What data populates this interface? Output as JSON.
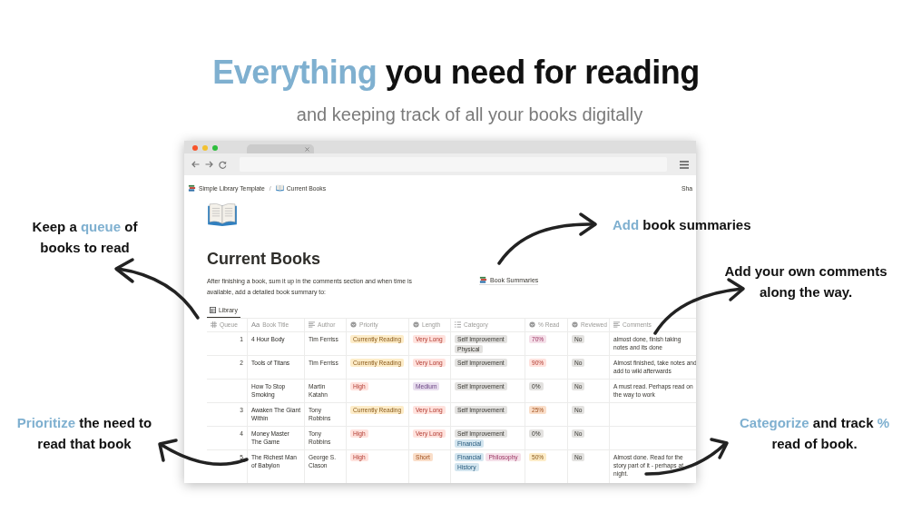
{
  "headline": {
    "accent": "Everything",
    "rest": "you need for reading"
  },
  "subtitle": "and keeping track of all your books digitally",
  "callouts": [
    {
      "segments": [
        {
          "text": "Keep a ",
          "accent": false
        },
        {
          "text": "queue",
          "accent": true
        },
        {
          "text": " of books to read",
          "accent": false
        }
      ]
    },
    {
      "segments": [
        {
          "text": "Add",
          "accent": true
        },
        {
          "text": " book summaries",
          "accent": false
        }
      ]
    },
    {
      "segments": [
        {
          "text": "Add your own comments along the way.",
          "accent": false
        }
      ]
    },
    {
      "segments": [
        {
          "text": "Prioritize",
          "accent": true
        },
        {
          "text": " the need to read that book",
          "accent": false
        }
      ]
    },
    {
      "segments": [
        {
          "text": "Categorize",
          "accent": true
        },
        {
          "text": " and track ",
          "accent": false
        },
        {
          "text": "%",
          "accent": true
        },
        {
          "text": " read of book.",
          "accent": false
        }
      ]
    }
  ],
  "page": {
    "breadcrumb": [
      "Simple Library Template",
      "/",
      "Current Books"
    ],
    "share": "Sha",
    "title": "Current Books",
    "description": "After finishing a book, sum it up in the comments section and when time is available, add a detailed book summary to:",
    "link": "Book Summaries",
    "view_tab": "Library",
    "table": {
      "columns": [
        {
          "label": "Queue",
          "kind": "number"
        },
        {
          "label": "Book Title",
          "kind": "title",
          "glyph": "Aa"
        },
        {
          "label": "Author",
          "kind": "text"
        },
        {
          "label": "Priority",
          "kind": "select"
        },
        {
          "label": "Length",
          "kind": "select"
        },
        {
          "label": "Category",
          "kind": "multi"
        },
        {
          "label": "% Read",
          "kind": "select"
        },
        {
          "label": "Reviewed",
          "kind": "select"
        },
        {
          "label": "Comments",
          "kind": "text"
        }
      ],
      "rows": [
        {
          "queue": "1",
          "title": "4 Hour Body",
          "author": "Tim Ferriss",
          "priority": {
            "text": "Currently Reading",
            "color": "#fdecc8"
          },
          "length": {
            "text": "Very Long",
            "color": "#ffe2dd"
          },
          "category": [
            {
              "text": "Self Improvement",
              "color": "#e3e2e0"
            },
            {
              "text": "Physical",
              "color": "#e3e2e0"
            }
          ],
          "read": {
            "text": "70%",
            "color": "#f5e0e9"
          },
          "reviewed": {
            "text": "No",
            "color": "#e3e2e0"
          },
          "comments": "almost done, finish taking notes and its done"
        },
        {
          "queue": "2",
          "title": "Tools of Titans",
          "author": "Tim Ferriss",
          "priority": {
            "text": "Currently Reading",
            "color": "#fdecc8"
          },
          "length": {
            "text": "Very Long",
            "color": "#ffe2dd"
          },
          "category": [
            {
              "text": "Self Improvement",
              "color": "#e3e2e0"
            }
          ],
          "read": {
            "text": "90%",
            "color": "#ffe2dd"
          },
          "reviewed": {
            "text": "No",
            "color": "#e3e2e0"
          },
          "comments": "Almost finished, take notes and add to wiki afterwards"
        },
        {
          "title": "How To Stop Smoking",
          "author": "Martin Katahn",
          "priority": {
            "text": "High",
            "color": "#ffe2dd"
          },
          "length": {
            "text": "Medium",
            "color": "#e8deee"
          },
          "category": [
            {
              "text": "Self Improvement",
              "color": "#e3e2e0"
            }
          ],
          "read": {
            "text": "0%",
            "color": "#e3e2e0"
          },
          "reviewed": {
            "text": "No",
            "color": "#e3e2e0"
          },
          "comments": "A must read. Perhaps read on the way to work"
        },
        {
          "queue": "3",
          "title": "Awaken The Giant Within",
          "author": "Tony Robbins",
          "priority": {
            "text": "Currently Reading",
            "color": "#fdecc8"
          },
          "length": {
            "text": "Very Long",
            "color": "#ffe2dd"
          },
          "category": [
            {
              "text": "Self Improvement",
              "color": "#e3e2e0"
            }
          ],
          "read": {
            "text": "25%",
            "color": "#fadec9"
          },
          "reviewed": {
            "text": "No",
            "color": "#e3e2e0"
          }
        },
        {
          "queue": "4",
          "title": "Money Master The Game",
          "author": "Tony Robbins",
          "priority": {
            "text": "High",
            "color": "#ffe2dd"
          },
          "length": {
            "text": "Very Long",
            "color": "#ffe2dd"
          },
          "category": [
            {
              "text": "Self Improvement",
              "color": "#e3e2e0"
            },
            {
              "text": "Financial",
              "color": "#d3e5ef"
            }
          ],
          "read": {
            "text": "0%",
            "color": "#e3e2e0"
          },
          "reviewed": {
            "text": "No",
            "color": "#e3e2e0"
          }
        },
        {
          "queue": "5",
          "title": "The Richest Man of Babylon",
          "author": "George S. Clason",
          "priority": {
            "text": "High",
            "color": "#ffe2dd"
          },
          "length": {
            "text": "Short",
            "color": "#fadec9"
          },
          "category": [
            {
              "text": "Financial",
              "color": "#d3e5ef"
            },
            {
              "text": "Philosophy",
              "color": "#f5e0e9"
            },
            {
              "text": "History",
              "color": "#d3e5ef"
            }
          ],
          "read": {
            "text": "50%",
            "color": "#fdecc8"
          },
          "reviewed": {
            "text": "No",
            "color": "#e3e2e0"
          },
          "comments": "Almost done. Read for the story part of it - perhaps at night."
        }
      ]
    }
  }
}
